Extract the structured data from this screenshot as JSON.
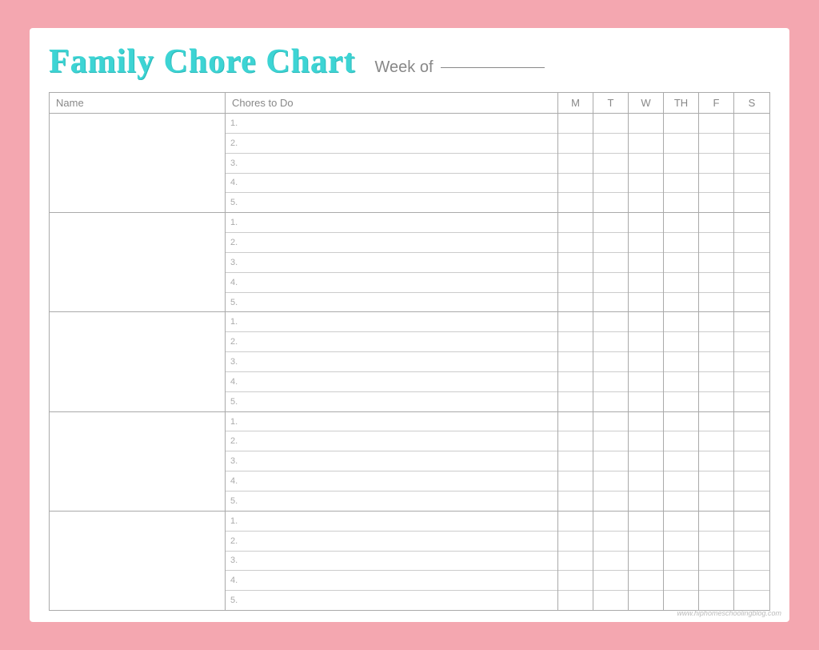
{
  "header": {
    "title": "Family Chore Chart",
    "week_of_label": "Week of",
    "week_line": ""
  },
  "table": {
    "col_name": "Name",
    "col_chores": "Chores to Do",
    "days": [
      "M",
      "T",
      "W",
      "TH",
      "F",
      "S"
    ],
    "num_chores_per_person": 5,
    "num_persons": 5,
    "chore_numbers": [
      "1.",
      "2.",
      "3.",
      "4.",
      "5."
    ]
  },
  "watermark": "www.hiphomeschoolingblog.com"
}
